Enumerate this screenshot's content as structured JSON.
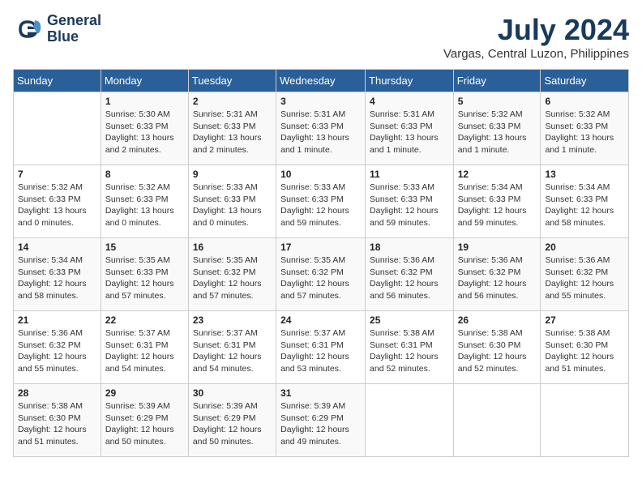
{
  "header": {
    "logo_line1": "General",
    "logo_line2": "Blue",
    "month": "July 2024",
    "location": "Vargas, Central Luzon, Philippines"
  },
  "weekdays": [
    "Sunday",
    "Monday",
    "Tuesday",
    "Wednesday",
    "Thursday",
    "Friday",
    "Saturday"
  ],
  "weeks": [
    [
      {
        "day": "",
        "text": ""
      },
      {
        "day": "1",
        "text": "Sunrise: 5:30 AM\nSunset: 6:33 PM\nDaylight: 13 hours\nand 2 minutes."
      },
      {
        "day": "2",
        "text": "Sunrise: 5:31 AM\nSunset: 6:33 PM\nDaylight: 13 hours\nand 2 minutes."
      },
      {
        "day": "3",
        "text": "Sunrise: 5:31 AM\nSunset: 6:33 PM\nDaylight: 13 hours\nand 1 minute."
      },
      {
        "day": "4",
        "text": "Sunrise: 5:31 AM\nSunset: 6:33 PM\nDaylight: 13 hours\nand 1 minute."
      },
      {
        "day": "5",
        "text": "Sunrise: 5:32 AM\nSunset: 6:33 PM\nDaylight: 13 hours\nand 1 minute."
      },
      {
        "day": "6",
        "text": "Sunrise: 5:32 AM\nSunset: 6:33 PM\nDaylight: 13 hours\nand 1 minute."
      }
    ],
    [
      {
        "day": "7",
        "text": "Sunrise: 5:32 AM\nSunset: 6:33 PM\nDaylight: 13 hours\nand 0 minutes."
      },
      {
        "day": "8",
        "text": "Sunrise: 5:32 AM\nSunset: 6:33 PM\nDaylight: 13 hours\nand 0 minutes."
      },
      {
        "day": "9",
        "text": "Sunrise: 5:33 AM\nSunset: 6:33 PM\nDaylight: 13 hours\nand 0 minutes."
      },
      {
        "day": "10",
        "text": "Sunrise: 5:33 AM\nSunset: 6:33 PM\nDaylight: 12 hours\nand 59 minutes."
      },
      {
        "day": "11",
        "text": "Sunrise: 5:33 AM\nSunset: 6:33 PM\nDaylight: 12 hours\nand 59 minutes."
      },
      {
        "day": "12",
        "text": "Sunrise: 5:34 AM\nSunset: 6:33 PM\nDaylight: 12 hours\nand 59 minutes."
      },
      {
        "day": "13",
        "text": "Sunrise: 5:34 AM\nSunset: 6:33 PM\nDaylight: 12 hours\nand 58 minutes."
      }
    ],
    [
      {
        "day": "14",
        "text": "Sunrise: 5:34 AM\nSunset: 6:33 PM\nDaylight: 12 hours\nand 58 minutes."
      },
      {
        "day": "15",
        "text": "Sunrise: 5:35 AM\nSunset: 6:33 PM\nDaylight: 12 hours\nand 57 minutes."
      },
      {
        "day": "16",
        "text": "Sunrise: 5:35 AM\nSunset: 6:32 PM\nDaylight: 12 hours\nand 57 minutes."
      },
      {
        "day": "17",
        "text": "Sunrise: 5:35 AM\nSunset: 6:32 PM\nDaylight: 12 hours\nand 57 minutes."
      },
      {
        "day": "18",
        "text": "Sunrise: 5:36 AM\nSunset: 6:32 PM\nDaylight: 12 hours\nand 56 minutes."
      },
      {
        "day": "19",
        "text": "Sunrise: 5:36 AM\nSunset: 6:32 PM\nDaylight: 12 hours\nand 56 minutes."
      },
      {
        "day": "20",
        "text": "Sunrise: 5:36 AM\nSunset: 6:32 PM\nDaylight: 12 hours\nand 55 minutes."
      }
    ],
    [
      {
        "day": "21",
        "text": "Sunrise: 5:36 AM\nSunset: 6:32 PM\nDaylight: 12 hours\nand 55 minutes."
      },
      {
        "day": "22",
        "text": "Sunrise: 5:37 AM\nSunset: 6:31 PM\nDaylight: 12 hours\nand 54 minutes."
      },
      {
        "day": "23",
        "text": "Sunrise: 5:37 AM\nSunset: 6:31 PM\nDaylight: 12 hours\nand 54 minutes."
      },
      {
        "day": "24",
        "text": "Sunrise: 5:37 AM\nSunset: 6:31 PM\nDaylight: 12 hours\nand 53 minutes."
      },
      {
        "day": "25",
        "text": "Sunrise: 5:38 AM\nSunset: 6:31 PM\nDaylight: 12 hours\nand 52 minutes."
      },
      {
        "day": "26",
        "text": "Sunrise: 5:38 AM\nSunset: 6:30 PM\nDaylight: 12 hours\nand 52 minutes."
      },
      {
        "day": "27",
        "text": "Sunrise: 5:38 AM\nSunset: 6:30 PM\nDaylight: 12 hours\nand 51 minutes."
      }
    ],
    [
      {
        "day": "28",
        "text": "Sunrise: 5:38 AM\nSunset: 6:30 PM\nDaylight: 12 hours\nand 51 minutes."
      },
      {
        "day": "29",
        "text": "Sunrise: 5:39 AM\nSunset: 6:29 PM\nDaylight: 12 hours\nand 50 minutes."
      },
      {
        "day": "30",
        "text": "Sunrise: 5:39 AM\nSunset: 6:29 PM\nDaylight: 12 hours\nand 50 minutes."
      },
      {
        "day": "31",
        "text": "Sunrise: 5:39 AM\nSunset: 6:29 PM\nDaylight: 12 hours\nand 49 minutes."
      },
      {
        "day": "",
        "text": ""
      },
      {
        "day": "",
        "text": ""
      },
      {
        "day": "",
        "text": ""
      }
    ]
  ]
}
